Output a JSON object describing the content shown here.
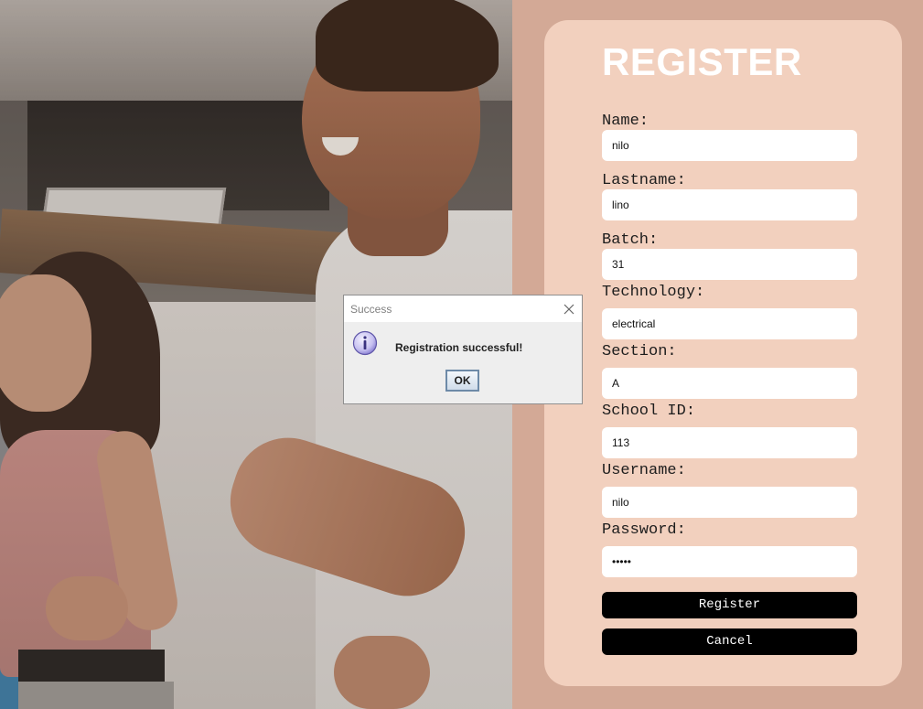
{
  "register": {
    "title": "REGISTER",
    "fields": {
      "name": {
        "label": "Name:",
        "value": "nilo"
      },
      "lastname": {
        "label": "Lastname:",
        "value": "lino"
      },
      "batch": {
        "label": "Batch:",
        "value": "31"
      },
      "technology": {
        "label": "Technology:",
        "value": "electrical"
      },
      "section": {
        "label": "Section:",
        "value": "A"
      },
      "school_id": {
        "label": "School ID:",
        "value": "113"
      },
      "username": {
        "label": "Username:",
        "value": "nilo"
      },
      "password": {
        "label": "Password:",
        "value": "•••••"
      }
    },
    "register_label": "Register",
    "cancel_label": "Cancel"
  },
  "dialog": {
    "title": "Success",
    "message": "Registration successful!",
    "ok_label": "OK",
    "icon": "info-icon"
  },
  "colors": {
    "background": "#d3a996",
    "card": "#f2d0be",
    "button": "#000000"
  }
}
